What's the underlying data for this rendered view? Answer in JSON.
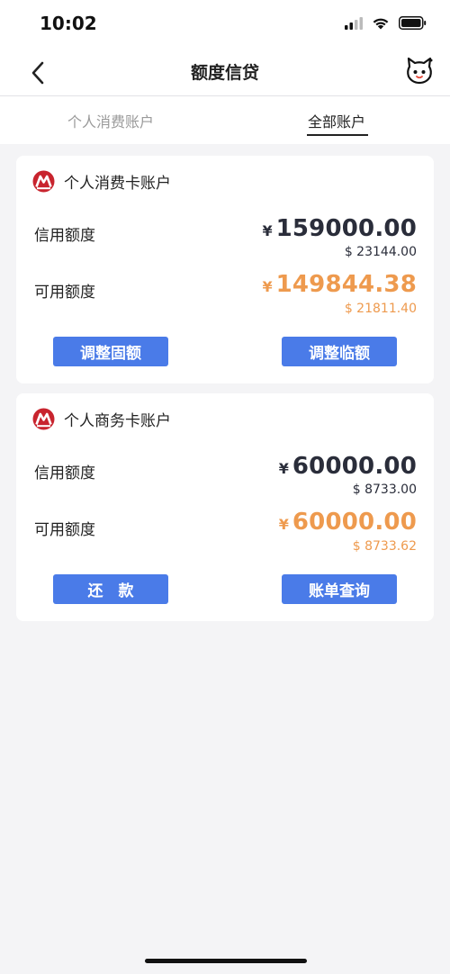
{
  "status_bar": {
    "time": "10:02"
  },
  "nav": {
    "title": "额度信贷",
    "back_icon": "chevron-left-icon",
    "mascot_icon": "cat-mascot-icon"
  },
  "tabs": [
    {
      "label": "个人消费账户",
      "active": false
    },
    {
      "label": "全部账户",
      "active": true
    }
  ],
  "cards": [
    {
      "title": "个人消费卡账户",
      "credit_label": "信用额度",
      "credit_currency": "¥",
      "credit_amount": "159000.00",
      "credit_usd": "$ 23144.00",
      "available_label": "可用额度",
      "available_currency": "¥",
      "available_amount": "149844.38",
      "available_usd": "$ 21811.40",
      "button_left": "调整固额",
      "button_right": "调整临额"
    },
    {
      "title": "个人商务卡账户",
      "credit_label": "信用额度",
      "credit_currency": "¥",
      "credit_amount": "60000.00",
      "credit_usd": "$ 8733.00",
      "available_label": "可用额度",
      "available_currency": "¥",
      "available_amount": "60000.00",
      "available_usd": "$ 8733.62",
      "button_left": "还　款",
      "button_right": "账单查询"
    }
  ],
  "colors": {
    "accent_button": "#4a7be8",
    "available_amount": "#ee9a4e",
    "credit_amount": "#2a2d3a",
    "bank_logo_red": "#c8242e",
    "page_background": "#f4f4f6"
  }
}
